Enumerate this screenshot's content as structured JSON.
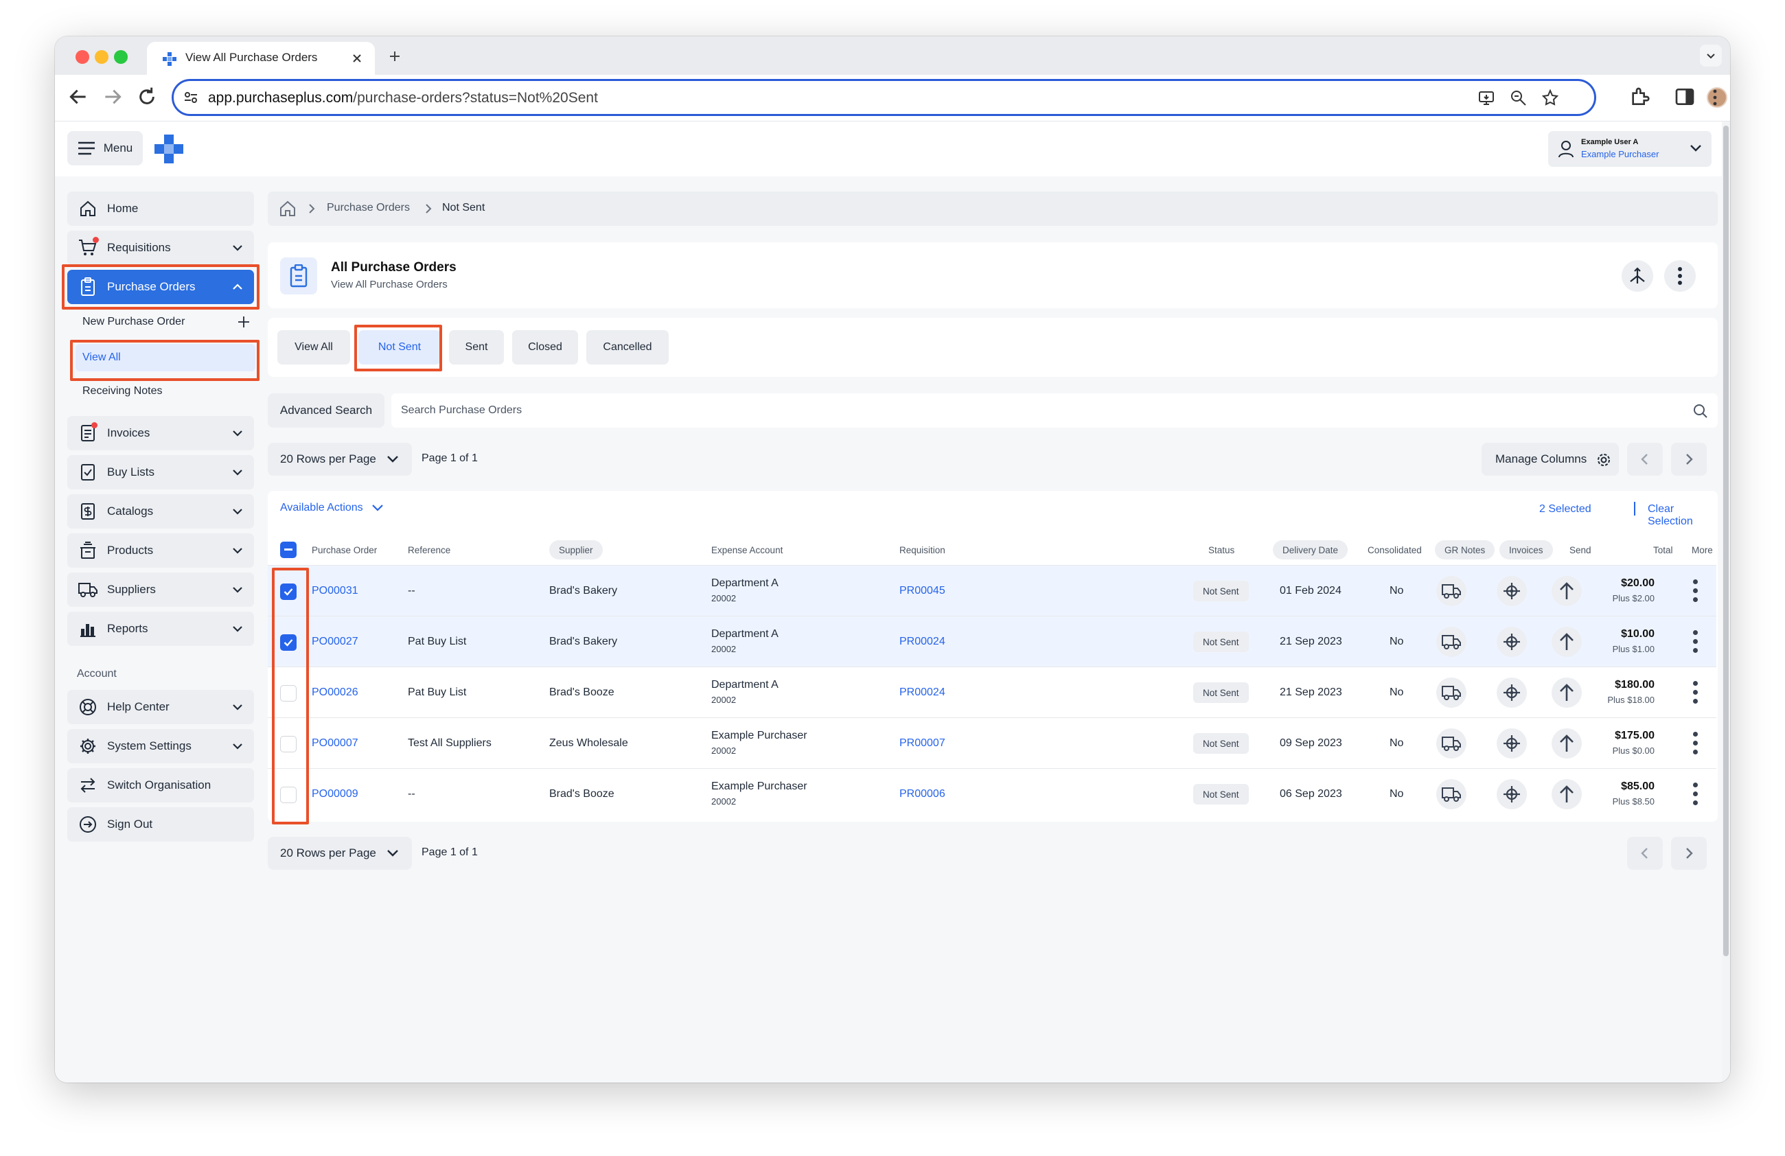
{
  "browser": {
    "tab_title": "View All Purchase Orders",
    "url_host": "app.purchaseplus.com",
    "url_path": "/purchase-orders?status=Not%20Sent"
  },
  "header": {
    "menu_label": "Menu",
    "user_name": "Example User A",
    "user_role": "Example Purchaser"
  },
  "sidebar": {
    "items": [
      {
        "label": "Home",
        "icon": "home-icon"
      },
      {
        "label": "Requisitions",
        "icon": "cart-icon"
      },
      {
        "label": "Purchase Orders",
        "icon": "clipboard-icon"
      },
      {
        "label": "Invoices",
        "icon": "invoice-icon"
      },
      {
        "label": "Buy Lists",
        "icon": "checklist-icon"
      },
      {
        "label": "Catalogs",
        "icon": "dollar-doc-icon"
      },
      {
        "label": "Products",
        "icon": "box-icon"
      },
      {
        "label": "Suppliers",
        "icon": "truck-icon"
      },
      {
        "label": "Reports",
        "icon": "bar-chart-icon"
      }
    ],
    "po_sub": {
      "new_po": "New Purchase Order",
      "view_all": "View All",
      "receiving": "Receiving Notes"
    },
    "account_heading": "Account",
    "account_items": [
      {
        "label": "Help Center"
      },
      {
        "label": "System Settings"
      },
      {
        "label": "Switch Organisation"
      },
      {
        "label": "Sign Out"
      }
    ]
  },
  "breadcrumb": {
    "level1": "Purchase Orders",
    "level2": "Not Sent"
  },
  "title_card": {
    "title": "All Purchase Orders",
    "subtitle": "View All Purchase Orders"
  },
  "filter_tabs": [
    "View All",
    "Not Sent",
    "Sent",
    "Closed",
    "Cancelled"
  ],
  "search": {
    "advanced_label": "Advanced Search",
    "placeholder": "Search Purchase Orders"
  },
  "pagination": {
    "rows_per_page": "20 Rows per Page",
    "page_info": "Page 1 of 1",
    "manage_columns": "Manage Columns"
  },
  "table_toolbar": {
    "available_actions": "Available Actions",
    "selected": "2 Selected",
    "clear": "Clear Selection"
  },
  "columns": [
    "Purchase Order",
    "Reference",
    "Supplier",
    "Expense Account",
    "Requisition",
    "Status",
    "Delivery Date",
    "Consolidated",
    "GR Notes",
    "Invoices",
    "Send",
    "Total",
    "More"
  ],
  "rows": [
    {
      "po": "PO00031",
      "reference": "--",
      "supplier": "Brad's Bakery",
      "account": "Department A",
      "account_code": "20002",
      "requisition": "PR00045",
      "status": "Not Sent",
      "delivery": "01 Feb 2024",
      "consolidated": "No",
      "total": "$20.00",
      "tax": "Plus $2.00",
      "selected": true
    },
    {
      "po": "PO00027",
      "reference": "Pat Buy List",
      "supplier": "Brad's Bakery",
      "account": "Department A",
      "account_code": "20002",
      "requisition": "PR00024",
      "status": "Not Sent",
      "delivery": "21 Sep 2023",
      "consolidated": "No",
      "total": "$10.00",
      "tax": "Plus $1.00",
      "selected": true
    },
    {
      "po": "PO00026",
      "reference": "Pat Buy List",
      "supplier": "Brad's Booze",
      "account": "Department A",
      "account_code": "20002",
      "requisition": "PR00024",
      "status": "Not Sent",
      "delivery": "21 Sep 2023",
      "consolidated": "No",
      "total": "$180.00",
      "tax": "Plus $18.00",
      "selected": false
    },
    {
      "po": "PO00007",
      "reference": "Test All Suppliers",
      "supplier": "Zeus Wholesale",
      "account": "Example Purchaser",
      "account_code": "20002",
      "requisition": "PR00007",
      "status": "Not Sent",
      "delivery": "09 Sep 2023",
      "consolidated": "No",
      "total": "$175.00",
      "tax": "Plus $0.00",
      "selected": false
    },
    {
      "po": "PO00009",
      "reference": "--",
      "supplier": "Brad's Booze",
      "account": "Example Purchaser",
      "account_code": "20002",
      "requisition": "PR00006",
      "status": "Not Sent",
      "delivery": "06 Sep 2023",
      "consolidated": "No",
      "total": "$85.00",
      "tax": "Plus $8.50",
      "selected": false
    }
  ],
  "colors": {
    "accent": "#2563eb",
    "highlight": "#e8502a",
    "brand": "#2b6fe0"
  }
}
